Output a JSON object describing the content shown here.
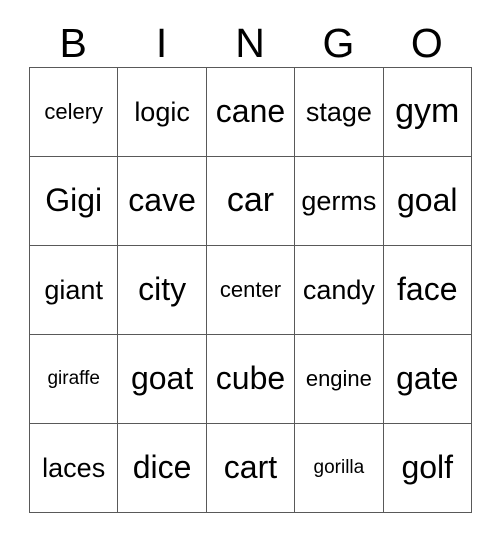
{
  "card": {
    "title": "BINGO",
    "headers": [
      "B",
      "I",
      "N",
      "G",
      "O"
    ],
    "rows": [
      [
        "celery",
        "logic",
        "cane",
        "stage",
        "gym"
      ],
      [
        "Gigi",
        "cave",
        "car",
        "germs",
        "goal"
      ],
      [
        "giant",
        "city",
        "center",
        "candy",
        "face"
      ],
      [
        "giraffe",
        "goat",
        "cube",
        "engine",
        "gate"
      ],
      [
        "laces",
        "dice",
        "cart",
        "gorilla",
        "golf"
      ]
    ]
  },
  "style": {
    "grid_line_color": "#595959",
    "text_color": "#000000",
    "background_color": "#ffffff"
  }
}
